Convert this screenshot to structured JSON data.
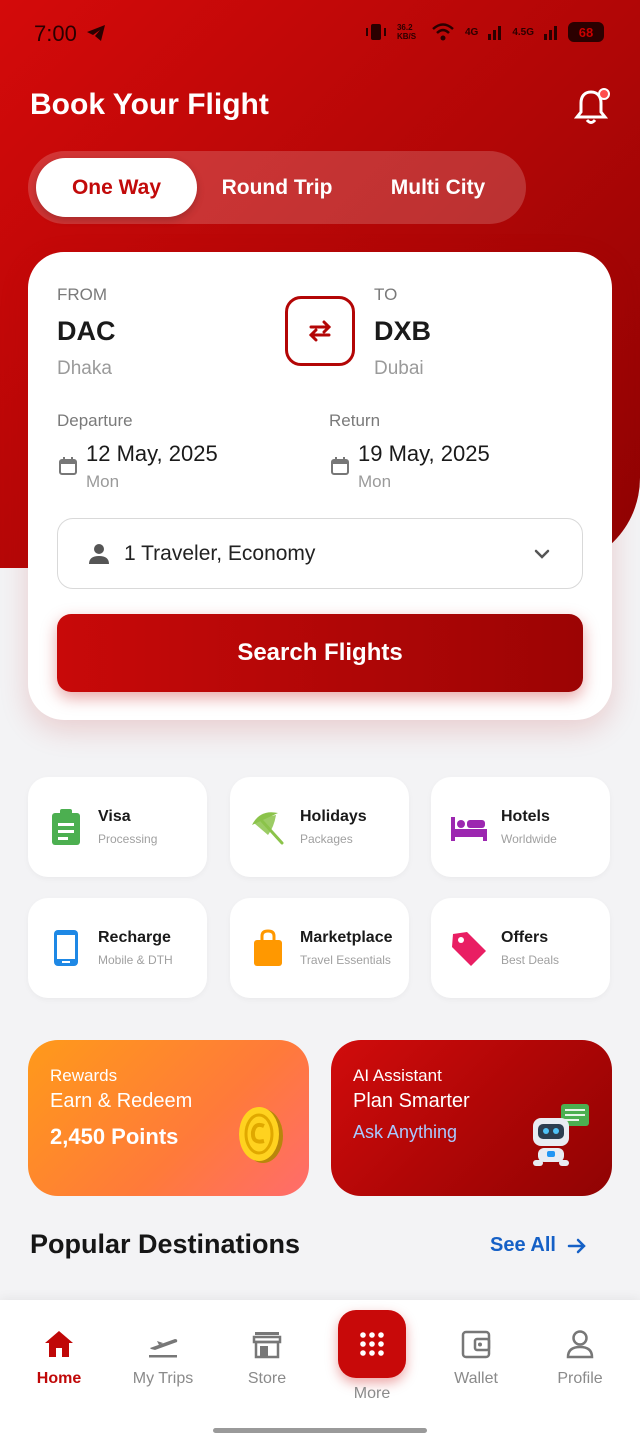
{
  "status_bar": {
    "time": "7:00",
    "net_speed": "36.2 KB/S",
    "sig1": "4G",
    "sig2": "4.5G",
    "battery": "68"
  },
  "header": {
    "title": "Book Your Flight"
  },
  "trip_tabs": [
    {
      "label": "One Way",
      "active": true
    },
    {
      "label": "Round Trip",
      "active": false
    },
    {
      "label": "Multi City",
      "active": false
    }
  ],
  "search": {
    "from": {
      "label": "FROM",
      "code": "DAC",
      "city": "Dhaka"
    },
    "to": {
      "label": "TO",
      "code": "DXB",
      "city": "Dubai"
    },
    "departure": {
      "label": "Departure",
      "date": "12 May, 2025",
      "day": "Mon"
    },
    "return": {
      "label": "Return",
      "date": "19 May, 2025",
      "day": "Mon"
    },
    "traveler": "1 Traveler, Economy",
    "button": "Search Flights"
  },
  "services": [
    {
      "title": "Visa",
      "subtitle": "Processing",
      "icon": "clipboard-icon",
      "color": "#4caf50"
    },
    {
      "title": "Holidays",
      "subtitle": "Packages",
      "icon": "umbrella-icon",
      "color": "#8bc34a"
    },
    {
      "title": "Hotels",
      "subtitle": "Worldwide",
      "icon": "bed-icon",
      "color": "#9c27b0"
    },
    {
      "title": "Recharge",
      "subtitle": "Mobile & DTH",
      "icon": "phone-icon",
      "color": "#1e88e5"
    },
    {
      "title": "Marketplace",
      "subtitle": "Travel Essentials",
      "icon": "shopping-bag-icon",
      "color": "#ff9800"
    },
    {
      "title": "Offers",
      "subtitle": "Best Deals",
      "icon": "tag-icon",
      "color": "#e91e63"
    }
  ],
  "promos": {
    "rewards": {
      "label": "Rewards",
      "line": "Earn & Redeem",
      "value": "2,450 Points"
    },
    "ai": {
      "label": "AI Assistant",
      "line": "Plan Smarter",
      "cta": "Ask Anything"
    }
  },
  "destinations": {
    "title": "Popular Destinations",
    "see_all": "See All"
  },
  "bottom_nav": [
    {
      "label": "Home",
      "icon": "home-icon",
      "active": true
    },
    {
      "label": "My Trips",
      "icon": "plane-icon",
      "active": false
    },
    {
      "label": "Store",
      "icon": "store-icon",
      "active": false
    },
    {
      "label": "More",
      "icon": "grid-icon",
      "active": false
    },
    {
      "label": "Wallet",
      "icon": "wallet-icon",
      "active": false
    },
    {
      "label": "Profile",
      "icon": "user-icon",
      "active": false
    }
  ],
  "colors": {
    "primary": "#c80909",
    "link": "#1560c6",
    "background": "#f3f3f5"
  }
}
